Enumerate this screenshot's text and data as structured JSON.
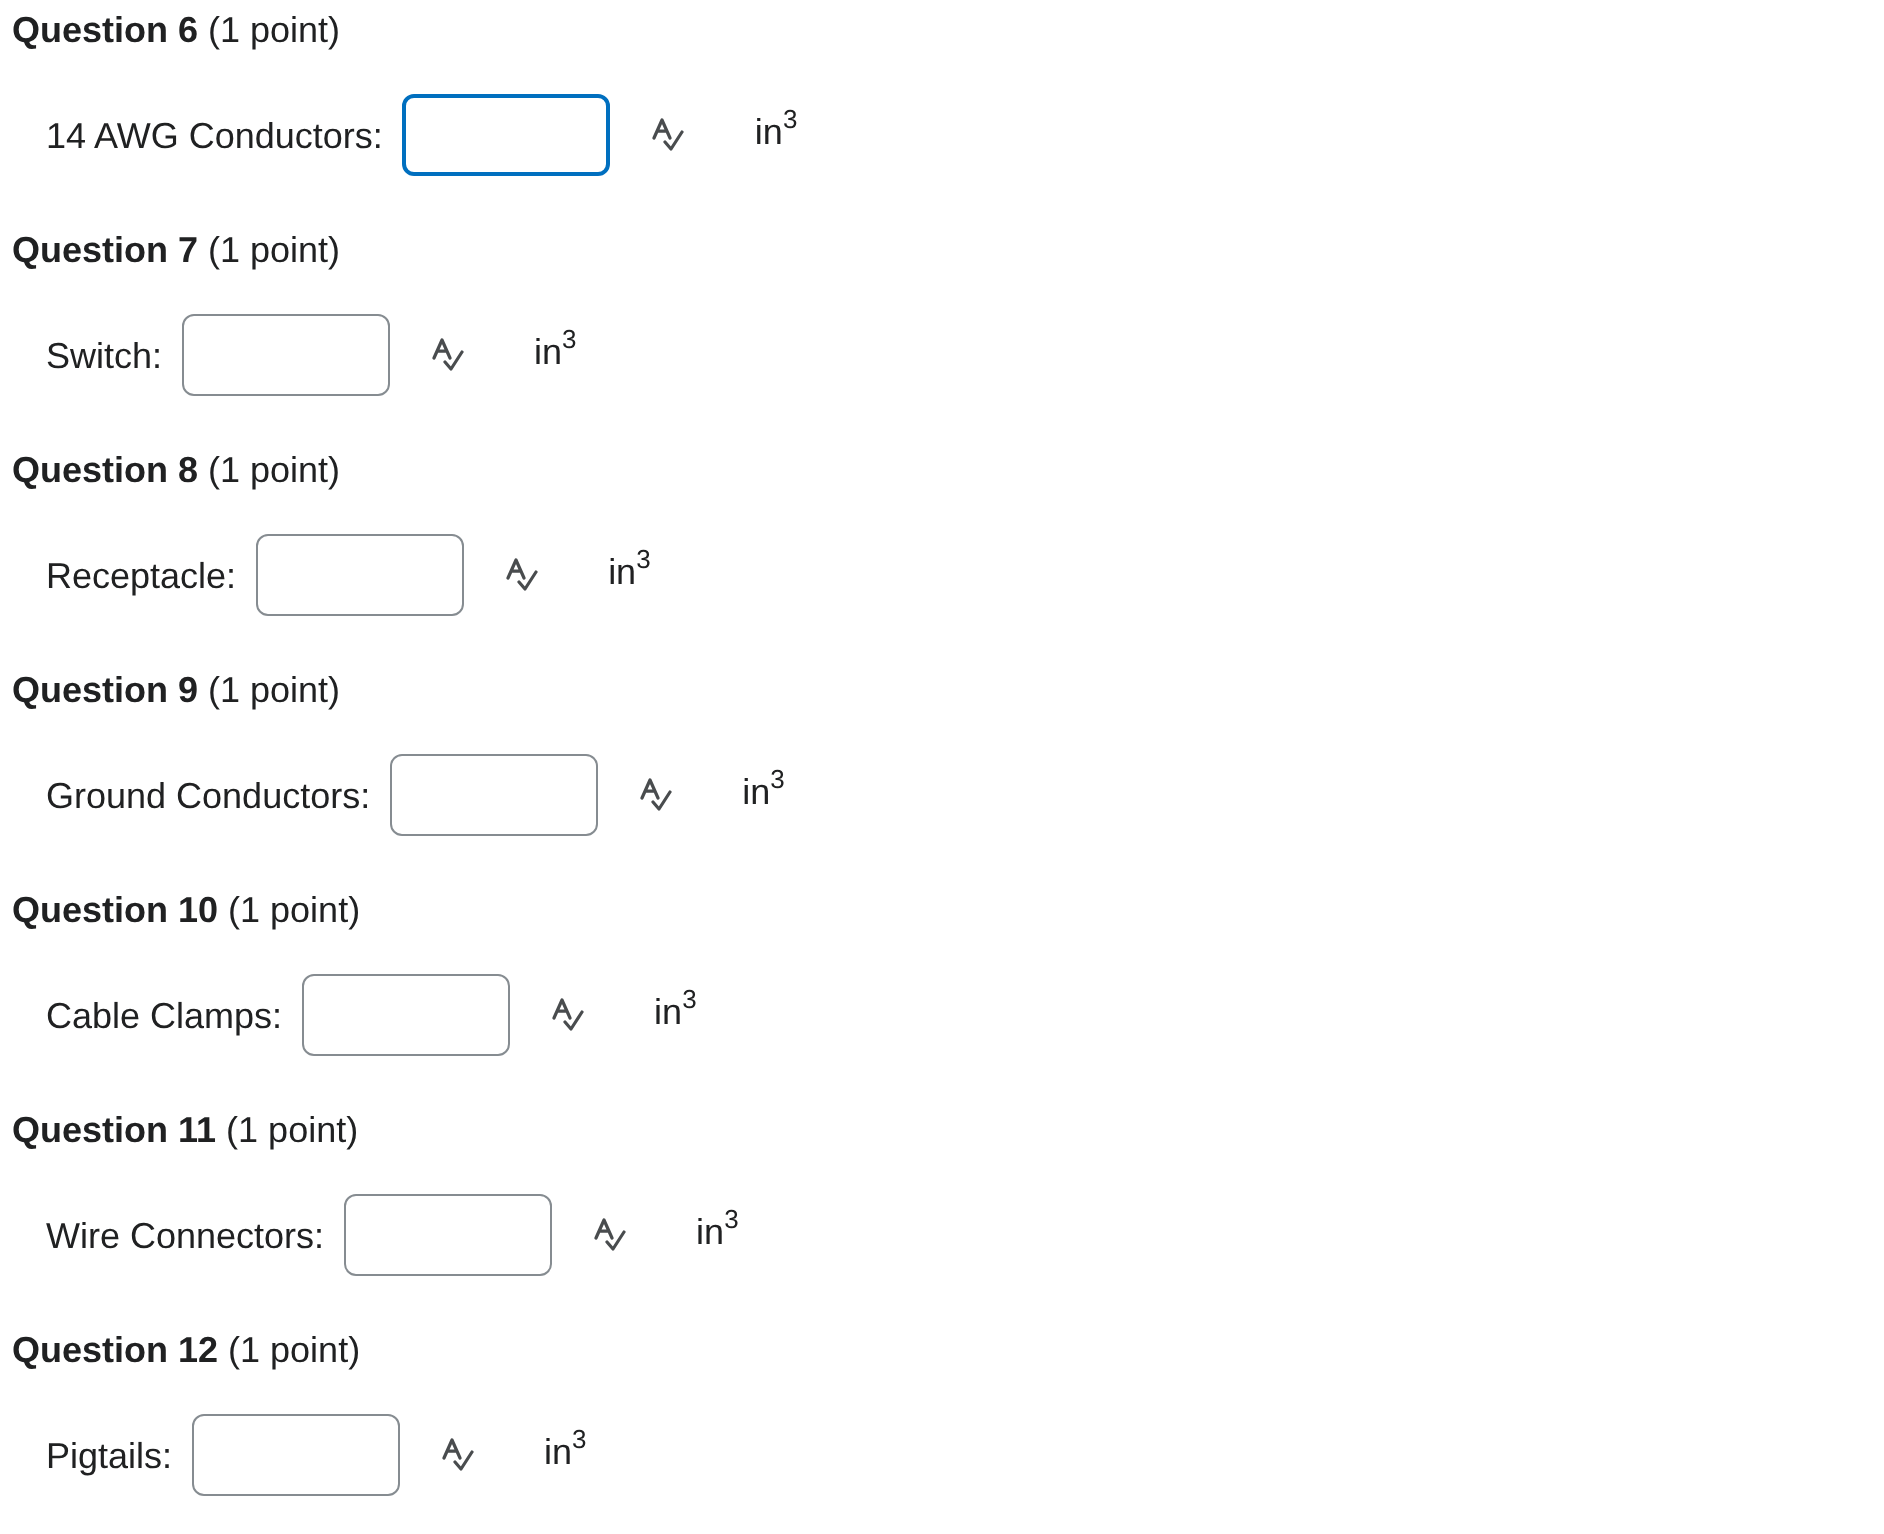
{
  "questions": [
    {
      "title": "**Question 6** (1 point)",
      "label": "14 AWG Conductors:",
      "field": {
        "focused": true
      },
      "unit": "in$^{3}$"
    },
    {
      "title": "**Question 7** (1 point)",
      "label": "Switch:",
      "field": {
        "focused": false
      },
      "unit": "in$^{3}$"
    },
    {
      "title": "**Question 8** (1 point)",
      "label": "Receptacle:",
      "field": {
        "focused": false
      },
      "unit": "in$^{3}$"
    },
    {
      "title": "**Question 9** (1 point)",
      "label": "Ground Conductors:",
      "field": {
        "focused": false
      },
      "unit": "in$^{3}$"
    },
    {
      "title": "**Question 10** (1 point)",
      "label": "Cable Clamps:",
      "field": {
        "focused": false
      },
      "unit": "in$^{3}$"
    },
    {
      "title": "**Question 11** (1 point)",
      "label": "Wire Connectors:",
      "field": {
        "focused": false
      },
      "unit": "in$^{3}$"
    },
    {
      "title": "**Question 12** (1 point)",
      "label": "Pigtails:",
      "field": {
        "focused": false
      },
      "unit": "in$^{3}$"
    }
  ]
}
